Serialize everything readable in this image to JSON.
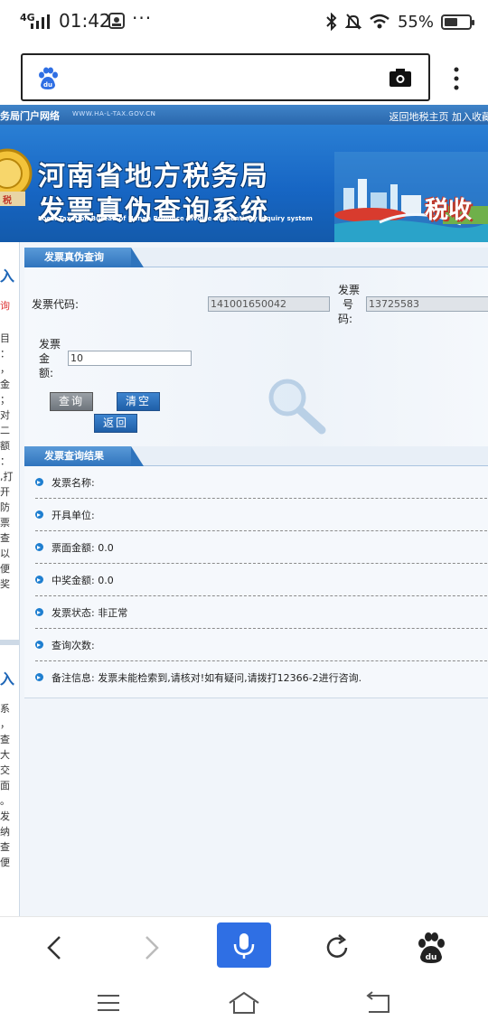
{
  "status_bar": {
    "network": "4G",
    "time": "01:42",
    "more": "···",
    "battery_pct": "55%",
    "battery_level": 0.55
  },
  "browser": {
    "url_text": ""
  },
  "site": {
    "top_left": "务局门户网络",
    "top_url": "WWW.HA-L-TAX.GOV.CN",
    "top_links": "返回地税主页 加入收藏",
    "title_line1": "河南省地方税务局",
    "title_line2": "发票真伪查询系统",
    "subtitle": "Local Taxation Bureau of Henan Province Invoice authenticity inquiry system",
    "banner_tag": "税收"
  },
  "left_sidebar": {
    "head1": "入",
    "lines1": [
      "询"
    ],
    "lines2": [
      "目",
      "：",
      "，",
      "金",
      "；",
      "对",
      "二",
      "额",
      "：",
      ",打",
      "开",
      "防",
      "票",
      "查",
      "以",
      "便",
      "奖"
    ],
    "head2": "入",
    "lines3": [
      "系",
      "，",
      "查",
      "大",
      "交",
      "面",
      "。",
      "发",
      "纳",
      "查",
      "便"
    ]
  },
  "query_panel": {
    "tab": "发票真伪查询",
    "code_label": "发票代码:",
    "code_value": "141001650042",
    "number_label_1": "发票",
    "number_label_2": "号",
    "number_label_3": "码:",
    "number_value": "13725583",
    "amount_label_1": "发票",
    "amount_label_2": "金",
    "amount_label_3": "额:",
    "amount_value": "10",
    "btn_query": "查询",
    "btn_clear": "清空",
    "btn_back": "返回"
  },
  "result_panel": {
    "tab": "发票查询结果",
    "rows": [
      "发票名称:",
      "开具单位:",
      "票面金额: 0.0",
      "中奖金额: 0.0",
      "发票状态: 非正常",
      "查询次数:",
      "备注信息: 发票未能检索到,请核对!如有疑问,请拨打12366-2进行咨询."
    ]
  },
  "icons": [
    "baidu-icon",
    "camera-icon",
    "more-menu-icon",
    "back-icon",
    "forward-icon",
    "mic-icon",
    "refresh-icon",
    "baidu-home-icon",
    "menu-icon",
    "home-icon",
    "return-icon"
  ],
  "colors": {
    "header_blue": "#1766c4",
    "tab_blue": "#2f74bd",
    "voice_blue": "#2f6fe4",
    "bullet_blue": "#1f7fd0"
  }
}
